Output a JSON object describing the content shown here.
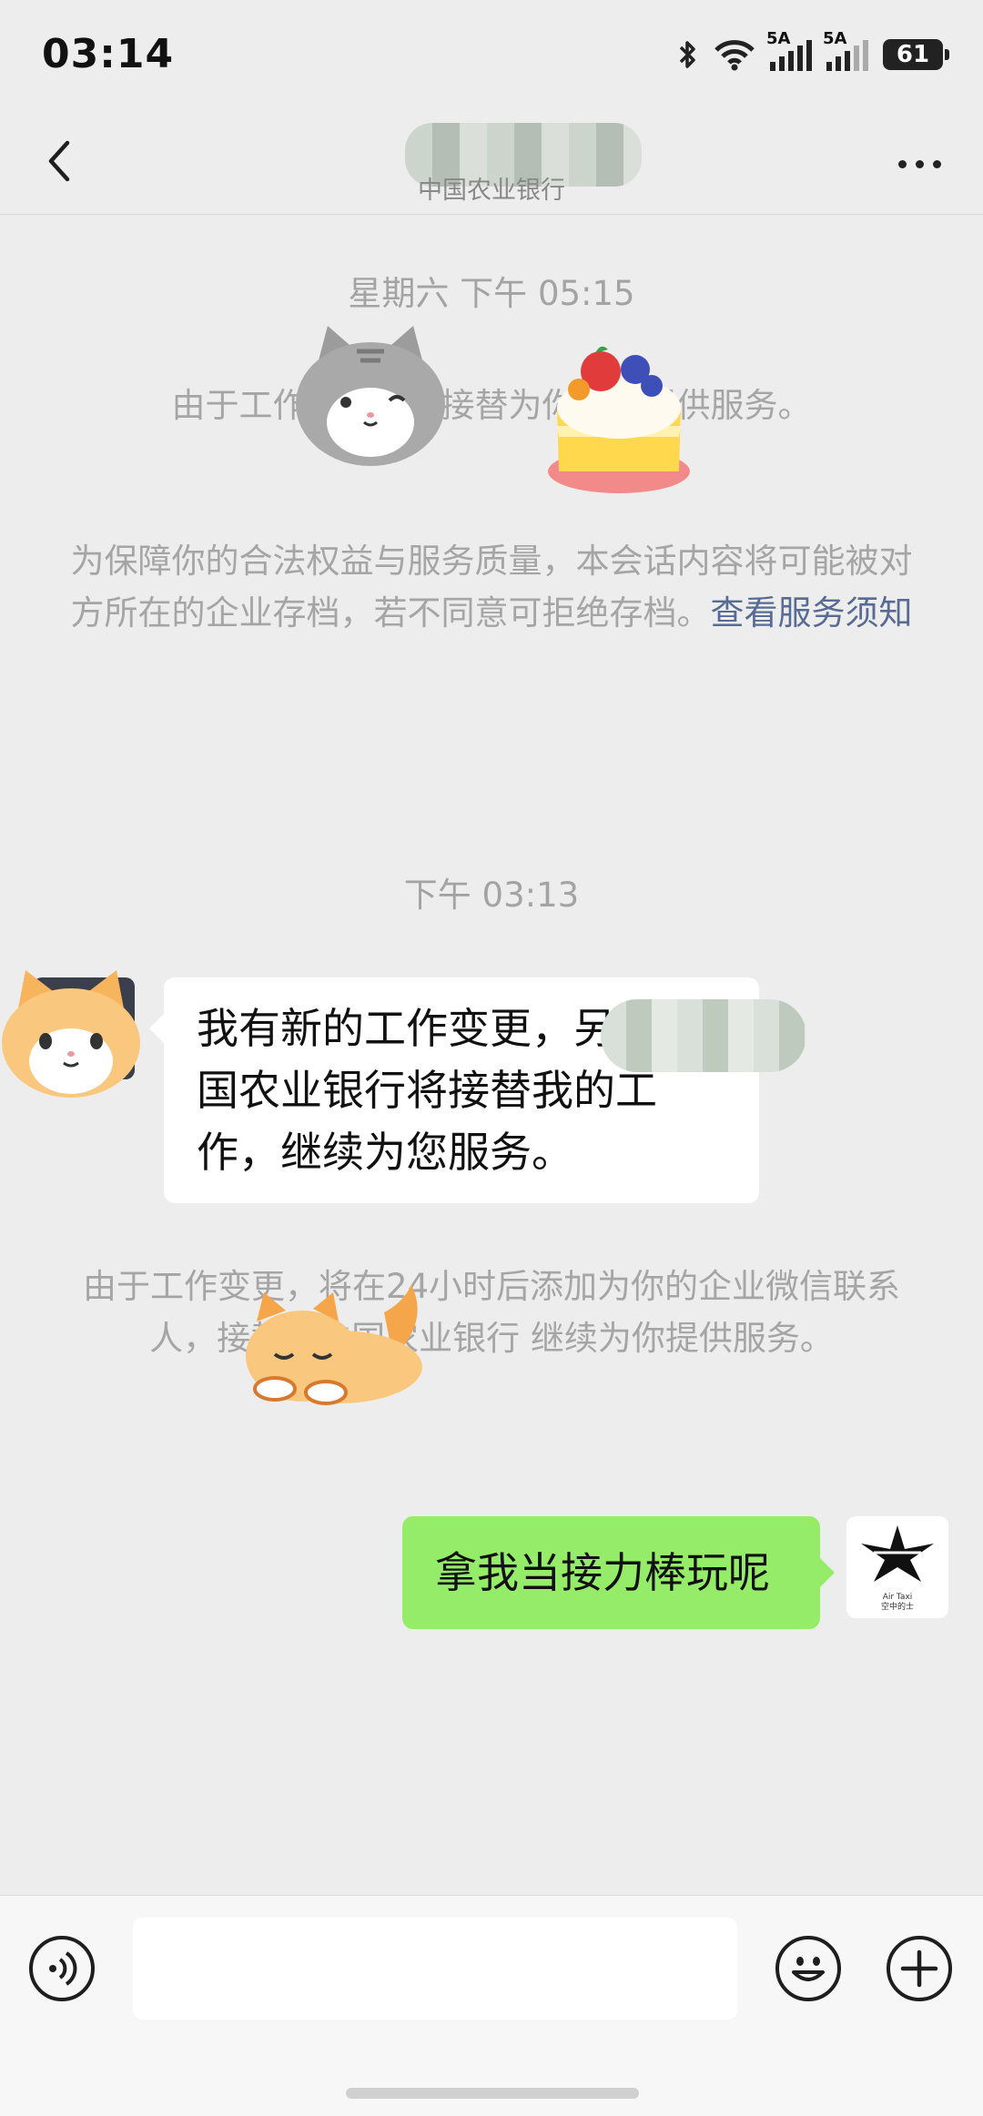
{
  "status_bar": {
    "time": "03:14",
    "sig1_label": "5A",
    "sig2_label": "5A",
    "battery": "61"
  },
  "header": {
    "subtitle": "中国农业银行"
  },
  "chat": {
    "timestamp_1": "星期六 下午 05:15",
    "system_1": "由于工作变更，已接替为你继续提供服务。",
    "notice_text": "为保障你的合法权益与服务质量，本会话内容将可能被对方所在的企业存档，若不同意可拒绝存档。",
    "notice_link": "查看服务须知",
    "timestamp_2": "下午 03:13",
    "incoming_message": "我有新的工作变更，另@中国农业银行将接替我的工作，继续为您服务。",
    "system_2": "由于工作变更，将在24小时后添加为你的企业微信联系人，接替@中国农业银行 继续为你提供服务。",
    "outgoing_message": "拿我当接力棒玩呢",
    "my_avatar_text_1": "Air Taxi",
    "my_avatar_text_2": "空中的士"
  },
  "colors": {
    "accent": "#95ec69",
    "link": "#576b95",
    "background": "#ededed"
  },
  "icons": [
    "bluetooth-icon",
    "wifi-icon",
    "back-icon",
    "more-icon",
    "voice-icon",
    "emoji-icon",
    "plus-icon"
  ]
}
